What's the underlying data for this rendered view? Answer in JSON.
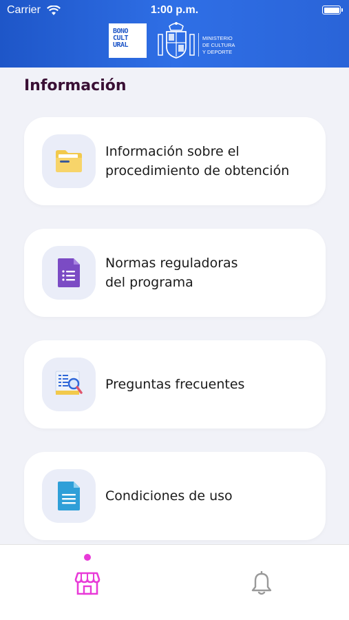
{
  "status_bar": {
    "carrier": "Carrier",
    "time": "1:00 p.m."
  },
  "header": {
    "logo_lines": [
      "BONO",
      "CULT",
      "URAL"
    ],
    "ministry_lines": [
      "MINISTERIO",
      "DE CULTURA",
      "Y DEPORTE"
    ]
  },
  "page": {
    "title": "Información"
  },
  "cards": [
    {
      "lines": [
        "Información sobre el",
        "procedimiento de obtención"
      ],
      "icon": "folder-icon"
    },
    {
      "lines": [
        "Normas reguladoras",
        "del programa"
      ],
      "icon": "document-list-icon"
    },
    {
      "lines": [
        "Preguntas frecuentes"
      ],
      "icon": "search-document-icon"
    },
    {
      "lines": [
        "Condiciones de uso"
      ],
      "icon": "document-icon"
    }
  ],
  "tabbar": {
    "tabs": [
      {
        "icon": "store-icon",
        "active": true
      },
      {
        "icon": "bell-icon",
        "active": false
      }
    ],
    "accent": "#e83ad8",
    "inactive": "#999999"
  },
  "colors": {
    "header": "#2a64d8",
    "title": "#3a1035",
    "background": "#f1f2f8"
  }
}
